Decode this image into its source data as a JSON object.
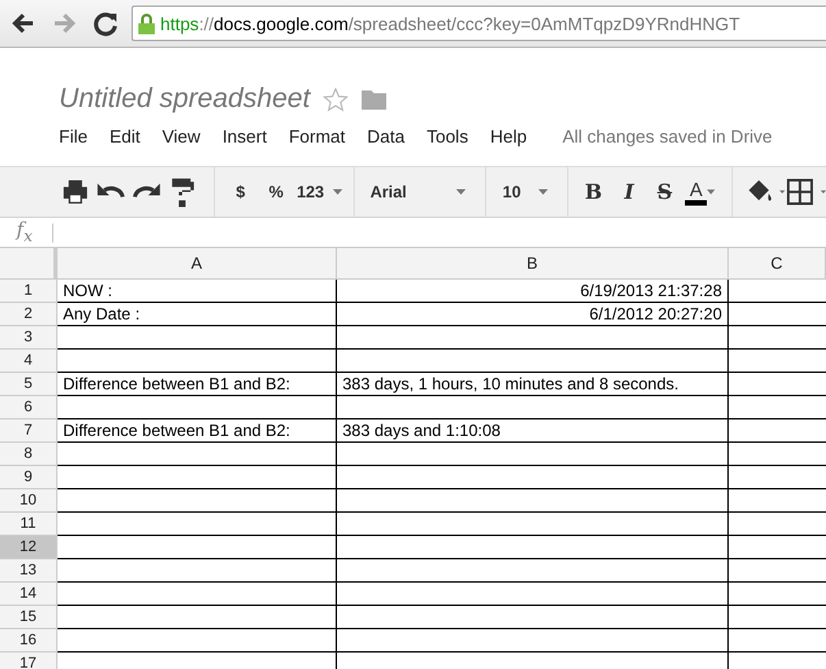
{
  "browser": {
    "url": {
      "scheme": "https",
      "separator": "://",
      "host": "docs.google.com",
      "path": "/spreadsheet/ccc?key=0AmMTqpzD9YRndHNGT"
    }
  },
  "document": {
    "title": "Untitled spreadsheet",
    "starred": false
  },
  "menu": [
    "File",
    "Edit",
    "View",
    "Insert",
    "Format",
    "Data",
    "Tools",
    "Help"
  ],
  "save_status": "All changes saved in Drive",
  "toolbar": {
    "currency": "$",
    "percent": "%",
    "number_format": "123",
    "font": "Arial",
    "font_size": "10",
    "bold": "B",
    "italic": "I",
    "strikethrough": "S",
    "text_color_label": "A"
  },
  "formula_bar": {
    "label": "f$_{x}$"
  },
  "columns": [
    "A",
    "B",
    "C"
  ],
  "rows": [
    {
      "number": "1",
      "selected": false,
      "cells": [
        {
          "text": "NOW :",
          "right_aligned": false
        },
        {
          "text": "6/19/2013 21:37:28",
          "right_aligned": true
        }
      ]
    },
    {
      "number": "2",
      "selected": false,
      "cells": [
        {
          "text": "Any Date :",
          "right_aligned": false
        },
        {
          "text": "6/1/2012 20:27:20",
          "right_aligned": true
        }
      ]
    },
    {
      "number": "3",
      "selected": false,
      "cells": []
    },
    {
      "number": "4",
      "selected": false,
      "cells": []
    },
    {
      "number": "5",
      "selected": false,
      "cells": [
        {
          "text": "Difference between B1 and B2:",
          "right_aligned": false
        },
        {
          "text": "383 days, 1 hours, 10 minutes and 8 seconds.",
          "right_aligned": false
        }
      ]
    },
    {
      "number": "6",
      "selected": false,
      "cells": []
    },
    {
      "number": "7",
      "selected": false,
      "cells": [
        {
          "text": "Difference between B1 and B2:",
          "right_aligned": false
        },
        {
          "text": "383 days and 1:10:08",
          "right_aligned": false
        }
      ]
    },
    {
      "number": "8",
      "selected": false,
      "cells": []
    },
    {
      "number": "9",
      "selected": false,
      "cells": []
    },
    {
      "number": "10",
      "selected": false,
      "cells": []
    },
    {
      "number": "11",
      "selected": false,
      "cells": []
    },
    {
      "number": "12",
      "selected": true,
      "cells": []
    },
    {
      "number": "13",
      "selected": false,
      "cells": []
    },
    {
      "number": "14",
      "selected": false,
      "cells": []
    },
    {
      "number": "15",
      "selected": false,
      "cells": []
    },
    {
      "number": "16",
      "selected": false,
      "cells": []
    },
    {
      "number": "17",
      "selected": false,
      "cells": []
    }
  ]
}
